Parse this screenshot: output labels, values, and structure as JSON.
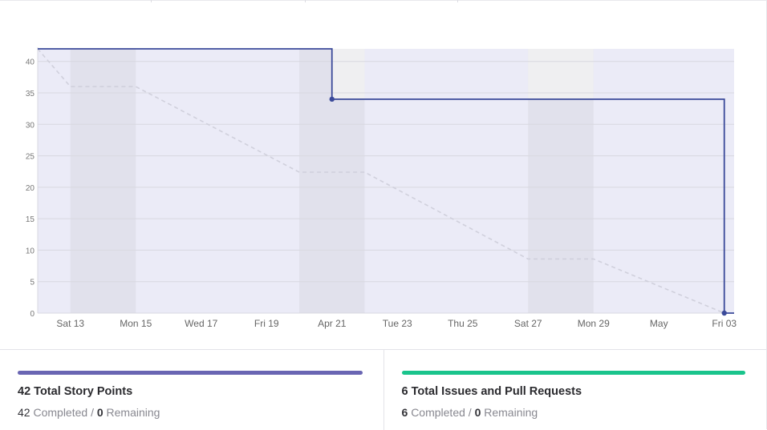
{
  "chart_data": {
    "type": "line",
    "x_labels": [
      "Sat 13",
      "Mon 15",
      "Wed 17",
      "Fri 19",
      "Apr 21",
      "Tue 23",
      "Thu 25",
      "Sat 27",
      "Mon 29",
      "May",
      "Fri 03"
    ],
    "ylim": [
      0,
      42
    ],
    "yticks": [
      0,
      5,
      10,
      15,
      20,
      25,
      30,
      35,
      40
    ],
    "grid": true,
    "weekend_bands": [
      [
        "Apr 13",
        "Apr 15"
      ],
      [
        "Apr 20",
        "Apr 22"
      ],
      [
        "Apr 27",
        "Apr 29"
      ]
    ],
    "series": [
      {
        "style": "solid-step",
        "color": "#3b4a9a",
        "points": [
          [
            "Apr 12",
            42
          ],
          [
            "Apr 21",
            42
          ],
          [
            "Apr 21",
            34
          ],
          [
            "May 3",
            34
          ],
          [
            "May 3",
            0
          ],
          [
            "May 3 end",
            0
          ]
        ],
        "markers": [
          [
            "Apr 21",
            34
          ],
          [
            "May 3",
            0
          ]
        ]
      },
      {
        "style": "dashed-ideal",
        "color": "#d0d0dc",
        "points": [
          [
            "Apr 12",
            42
          ],
          [
            "Apr 13",
            36
          ],
          [
            "Apr 15",
            36
          ],
          [
            "Apr 20",
            22.4
          ],
          [
            "Apr 22",
            22.4
          ],
          [
            "Apr 27",
            8.6
          ],
          [
            "Apr 29",
            8.6
          ],
          [
            "May 3",
            0
          ]
        ]
      }
    ]
  },
  "stats": [
    {
      "color": "#6a66b3",
      "title": "42 Total Story Points",
      "completed_num": "42",
      "completed_label": "Completed",
      "separator": "/",
      "remaining_num": "0",
      "remaining_label": "Remaining"
    },
    {
      "color": "#1ac48c",
      "title": "6 Total Issues and Pull Requests",
      "completed_num": "6",
      "completed_label": "Completed",
      "separator": "/",
      "remaining_num": "0",
      "remaining_label": "Remaining"
    }
  ]
}
